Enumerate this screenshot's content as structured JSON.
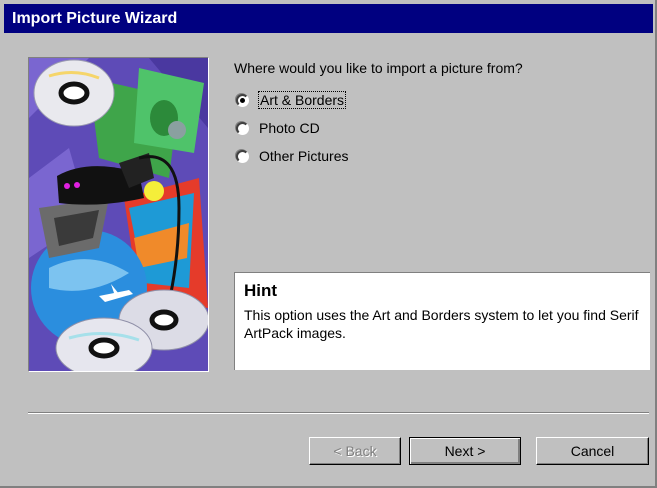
{
  "window": {
    "title": "Import Picture Wizard"
  },
  "question": "Where would you like to import a picture from?",
  "options": [
    {
      "label": "Art & Borders",
      "checked": true
    },
    {
      "label": "Photo CD",
      "checked": false
    },
    {
      "label": "Other Pictures",
      "checked": false
    }
  ],
  "hint": {
    "title": "Hint",
    "text": "This option uses the Art and Borders system to let you find Serif ArtPack images."
  },
  "buttons": {
    "back": "< Back",
    "next": "Next >",
    "cancel": "Cancel"
  },
  "colors": {
    "titlebar": "#000080",
    "face": "#c0c0c0",
    "art_bg": "#5e4bb7"
  }
}
